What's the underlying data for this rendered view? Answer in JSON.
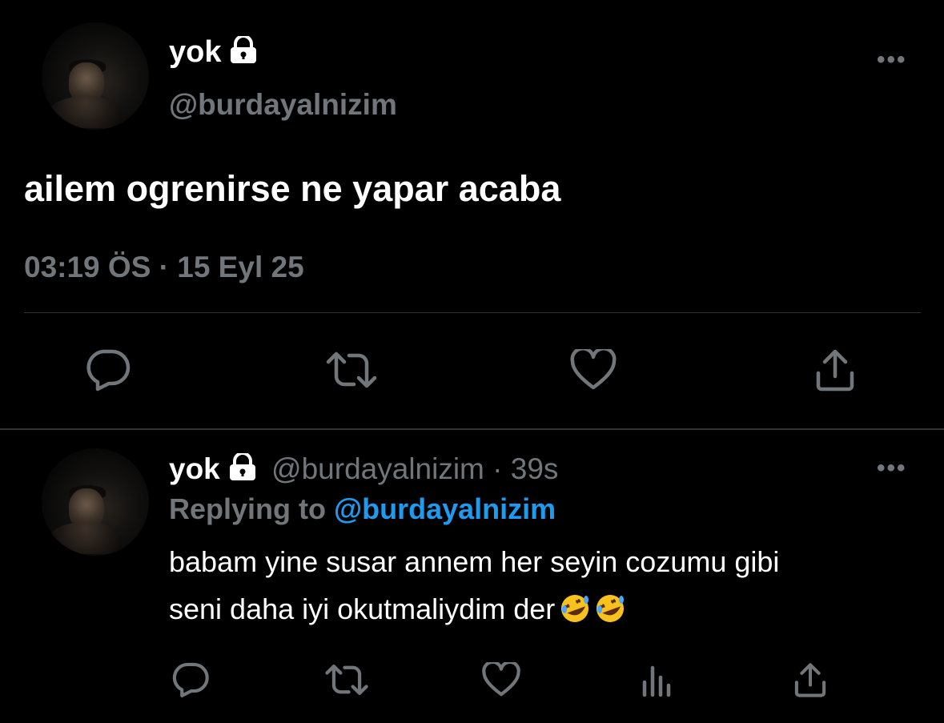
{
  "main_tweet": {
    "display_name": "yok",
    "handle": "@burdayalnizim",
    "more": "•••",
    "text": "ailem ogrenirse ne yapar acaba",
    "timestamp": "03:19 ÖS · 15 Eyl 25",
    "icons": {
      "lock": "lock-icon",
      "reply": "reply-icon",
      "retweet": "retweet-icon",
      "like": "heart-icon",
      "share": "share-icon"
    }
  },
  "reply_tweet": {
    "display_name": "yok",
    "handle": "@burdayalnizim",
    "age": "· 39s",
    "more": "•••",
    "replying_label": "Replying to",
    "replying_handle": "@burdayalnizim",
    "text_line1": "babam yine susar annem her seyin cozumu gibi",
    "text_line2": "seni daha iyi okutmaliydim der",
    "emojis": [
      "rolling-on-floor-laughing-emoji",
      "rolling-on-floor-laughing-emoji"
    ],
    "icons": {
      "reply": "reply-icon",
      "retweet": "retweet-icon",
      "like": "heart-icon",
      "views": "views-icon",
      "share": "share-icon"
    }
  },
  "colors": {
    "background": "#000000",
    "primary_text": "#ffffff",
    "secondary_text": "#71767b",
    "link": "#1d9bf0",
    "divider": "#2f3336"
  }
}
